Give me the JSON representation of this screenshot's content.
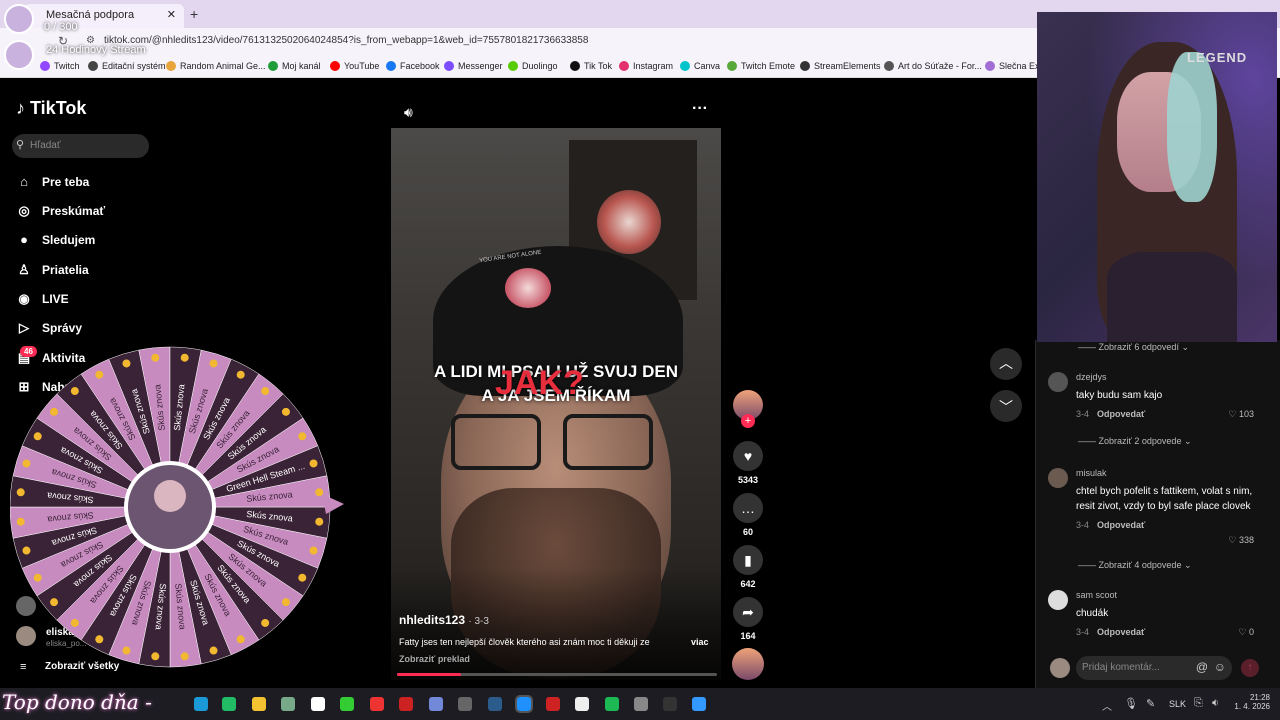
{
  "browser": {
    "tab_title": "Mesačná podpora",
    "url": "tiktok.com/@nhledits123/video/7613132502064024854?is_from_webapp=1&web_id=7557801821736633858",
    "bookmarks": [
      {
        "label": "Twitch",
        "color": "#9146ff"
      },
      {
        "label": "Editační systém",
        "color": "#444"
      },
      {
        "label": "Random Animal Ge...",
        "color": "#e8a33a"
      },
      {
        "label": "Moj kanál",
        "color": "#1f9d3a"
      },
      {
        "label": "YouTube",
        "color": "#ff0000"
      },
      {
        "label": "Facebook",
        "color": "#1877f2"
      },
      {
        "label": "Messenger",
        "color": "#7b4dff"
      },
      {
        "label": "Duolingo",
        "color": "#58cc02"
      },
      {
        "label": "Tik Tok",
        "color": "#111"
      },
      {
        "label": "Instagram",
        "color": "#e1306c"
      },
      {
        "label": "Canva",
        "color": "#00c4cc"
      },
      {
        "label": "Twitch Emote",
        "color": "#58a83a"
      },
      {
        "label": "StreamElements",
        "color": "#333"
      },
      {
        "label": "Art do Súťaže - For...",
        "color": "#555"
      },
      {
        "label": "Slečna Exis",
        "color": "#a06cd5"
      }
    ]
  },
  "stream_overlay": {
    "goal_count": "0 / 300",
    "goal_title": "24 Hodinový Stream",
    "bottom_banner": "Top dono dňa -"
  },
  "tiktok": {
    "logo": "TikTok",
    "search_placeholder": "Hľadať",
    "nav": [
      {
        "label": "Pre teba",
        "icon": "home-icon",
        "glyph": "⌂"
      },
      {
        "label": "Preskúmať",
        "icon": "compass-icon",
        "glyph": "◎"
      },
      {
        "label": "Sledujem",
        "icon": "following-avatar-icon",
        "glyph": "●"
      },
      {
        "label": "Priatelia",
        "icon": "friends-icon",
        "glyph": "♙"
      },
      {
        "label": "LIVE",
        "icon": "live-icon",
        "glyph": "◉"
      },
      {
        "label": "Správy",
        "icon": "messages-icon",
        "glyph": "▷"
      },
      {
        "label": "Aktivita",
        "icon": "activity-icon",
        "glyph": "▤"
      },
      {
        "label": "Nahrať",
        "icon": "upload-icon",
        "glyph": "⊞"
      }
    ],
    "activity_badge": "46",
    "following_account": {
      "name": "eliska_",
      "handle": "eliska_po..."
    },
    "show_all": "Zobraziť všetky",
    "video": {
      "caption_line1": "A LIDI MI PSALI UŽ SVUJ DEN",
      "caption_line2": "A JA JSEM ŘÍKAM",
      "overlay_word": "JAK?",
      "cap_text": "YOU ARE NOT ALONE",
      "author": "nhledits123",
      "date": "3-3",
      "description": "Fatty jses ten nejlepší člověk kterého asi znám moc ti děkuji ze",
      "more": "viac",
      "translate": "Zobraziť preklad"
    },
    "actions": {
      "likes": "5343",
      "comments": "60",
      "saves": "642",
      "shares": "164"
    },
    "comments": [
      {
        "type": "more",
        "text": "Zobraziť 6 odpovedí"
      },
      {
        "name": "dzejdys",
        "text": "taky budu sam kajo",
        "date": "3-4",
        "reply": "Odpovedať",
        "likes": "103"
      },
      {
        "type": "more",
        "text": "Zobraziť 2 odpovede"
      },
      {
        "name": "misulak",
        "text": "chtel bych pofelit s fattikem, volat s nim, resit zivot, vzdy to byl safe place clovek",
        "date": "3-4",
        "reply": "Odpovedať",
        "likes": "338"
      },
      {
        "type": "more",
        "text": "Zobraziť 4 odpovede"
      },
      {
        "name": "sam scoot",
        "text": "chudák",
        "date": "3-4",
        "reply": "Odpovedať",
        "likes": "0"
      }
    ],
    "comment_placeholder": "Pridaj komentár..."
  },
  "wheel": {
    "segments": [
      "Skús znova",
      "Green Hell Steam ..."
    ]
  },
  "webcam": {
    "headset_brand": "LEGEND"
  },
  "taskbar": {
    "lang": "SLK",
    "time": "21:28",
    "date": "1. 4. 2026"
  },
  "colors": {
    "accent": "#fe2c55",
    "wheel_pink": "#c78bc0",
    "wheel_dark": "#3b2337"
  }
}
